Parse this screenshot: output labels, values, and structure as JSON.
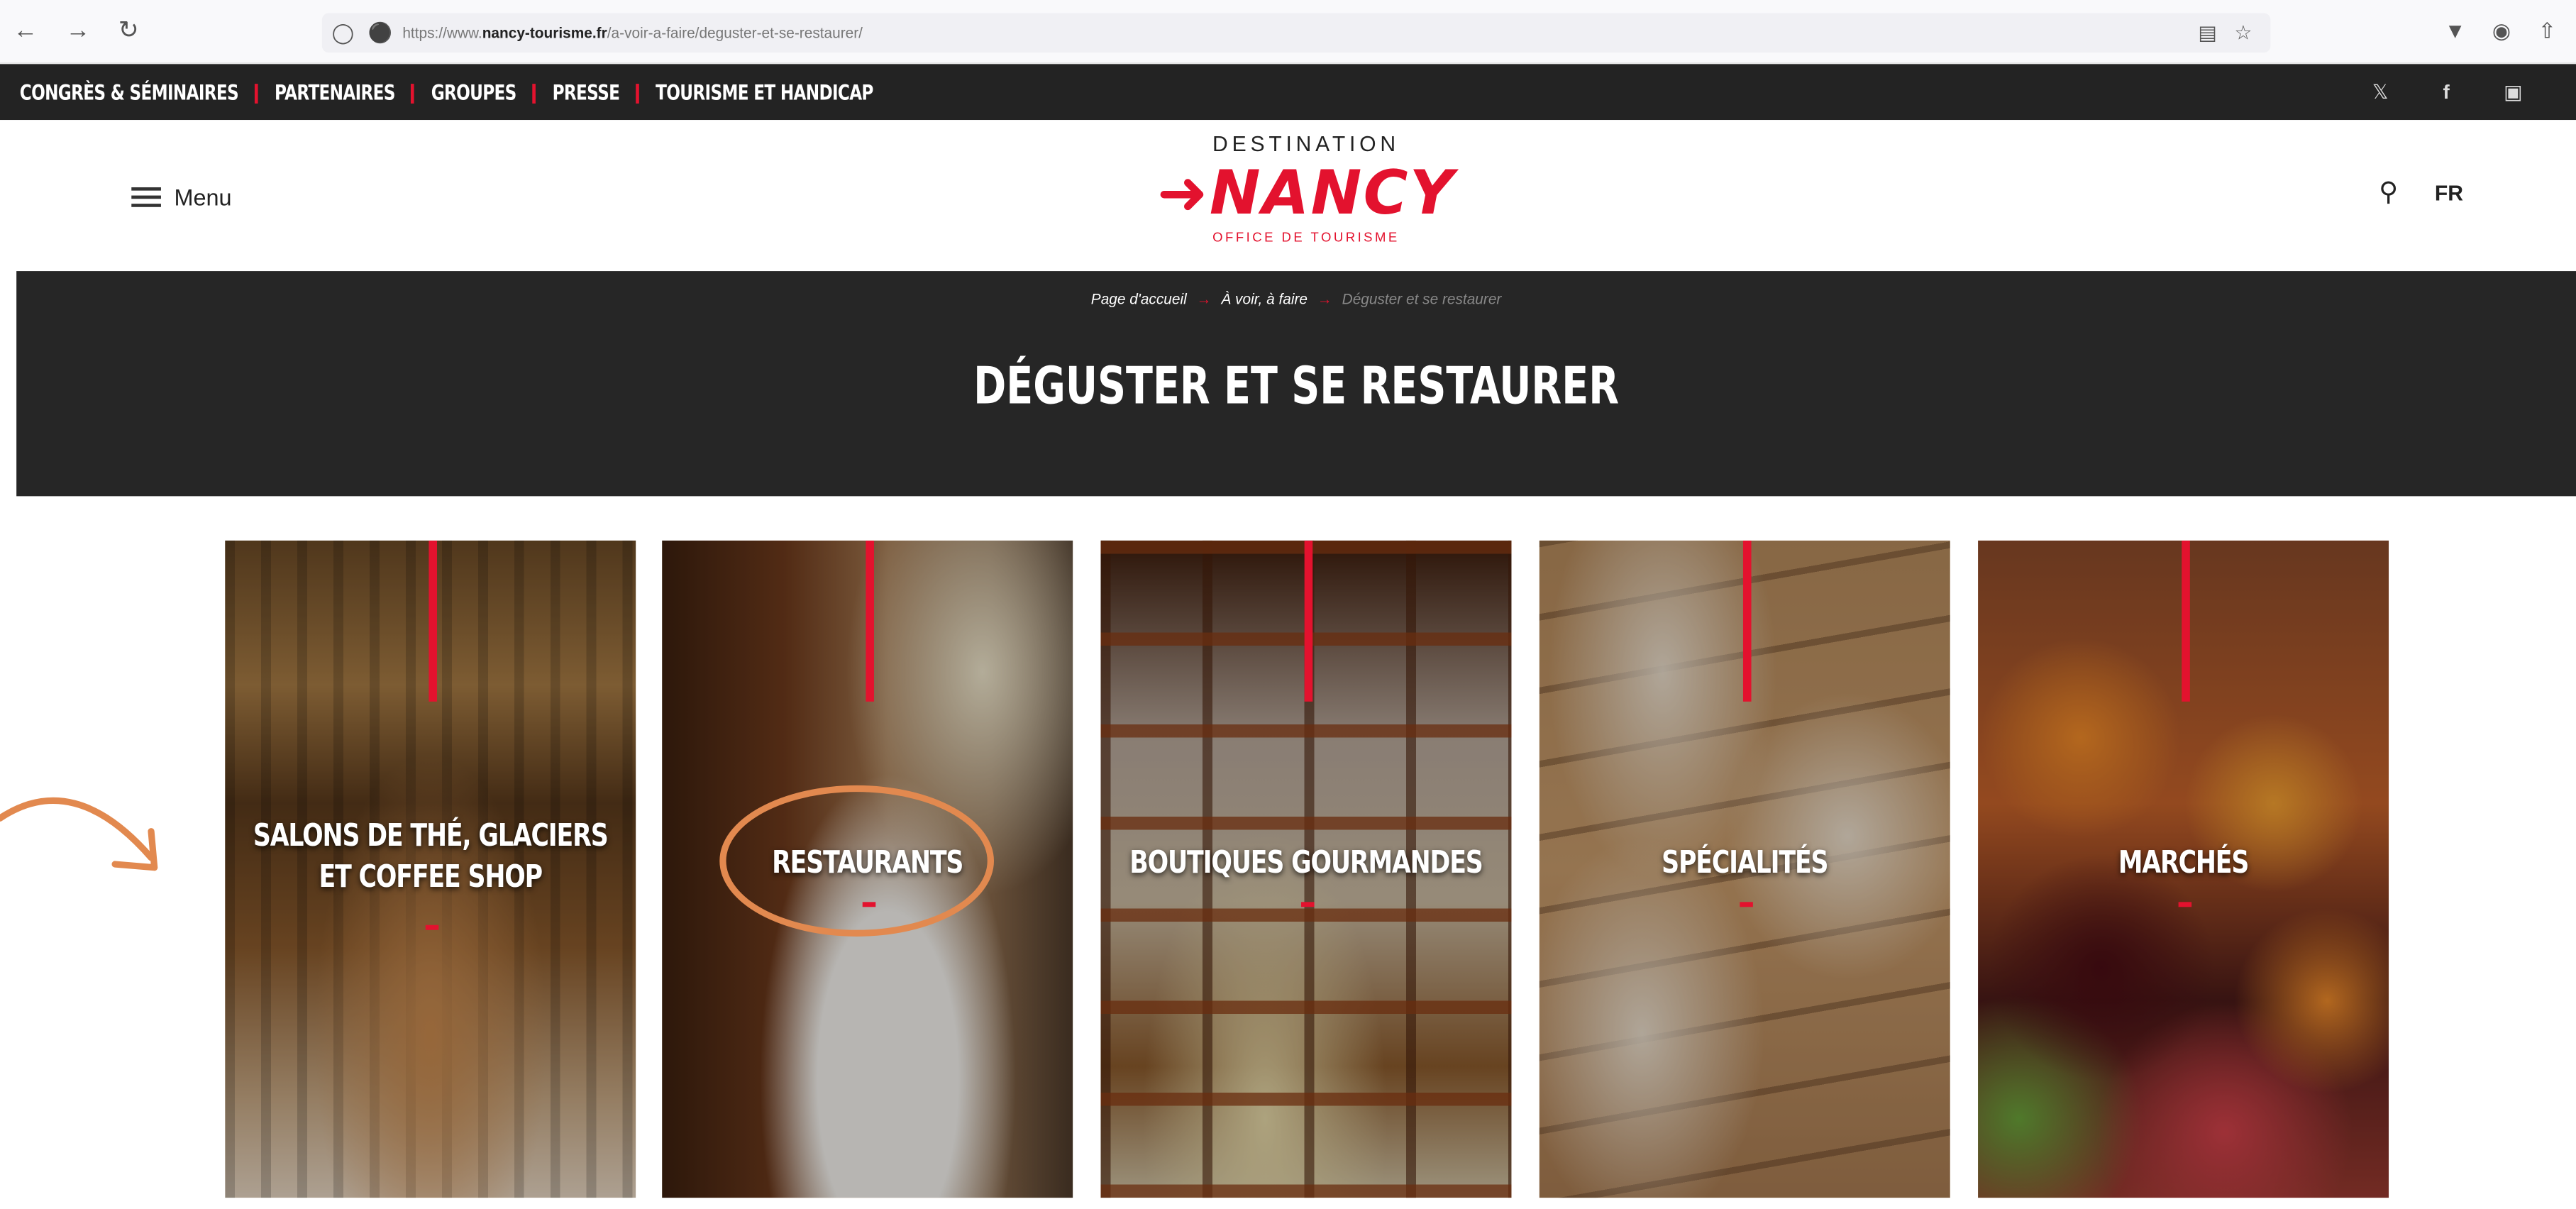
{
  "browser": {
    "url_prefix": "https://www.",
    "url_domain": "nancy-tourisme.fr",
    "url_path": "/a-voir-a-faire/deguster-et-se-restaurer/",
    "icons": [
      "back-icon",
      "forward-icon",
      "reload-icon",
      "shield-icon",
      "lock-icon",
      "reader-icon",
      "bookmark-star-icon",
      "pocket-icon",
      "extension-icon",
      "share-icon"
    ]
  },
  "topbar": {
    "links": [
      "Congrès & Séminaires",
      "Partenaires",
      "Groupes",
      "Presse",
      "Tourisme et handicap"
    ],
    "social": [
      "x-icon",
      "facebook-icon",
      "instagram-icon"
    ]
  },
  "header": {
    "menu_label": "Menu",
    "logo_top": "DESTINATION",
    "logo_main": "NANCY",
    "logo_sub": "OFFICE DE TOURISME",
    "lang": "FR"
  },
  "hero": {
    "breadcrumb": [
      "Page d'accueil",
      "À voir, à faire",
      "Déguster et se restaurer"
    ],
    "title": "DÉGUSTER ET SE RESTAURER"
  },
  "cards": [
    {
      "label_line1": "SALONS DE THÉ, GLACIERS",
      "label_line2": "ET COFFEE SHOP"
    },
    {
      "label": "RESTAURANTS"
    },
    {
      "label": "BOUTIQUES GOURMANDES"
    },
    {
      "label": "SPÉCIALITÉS"
    },
    {
      "label": "MARCHÉS"
    }
  ],
  "colors": {
    "accent": "#e3122e",
    "annotation": "#e2894f",
    "dark_bar": "#232323"
  }
}
